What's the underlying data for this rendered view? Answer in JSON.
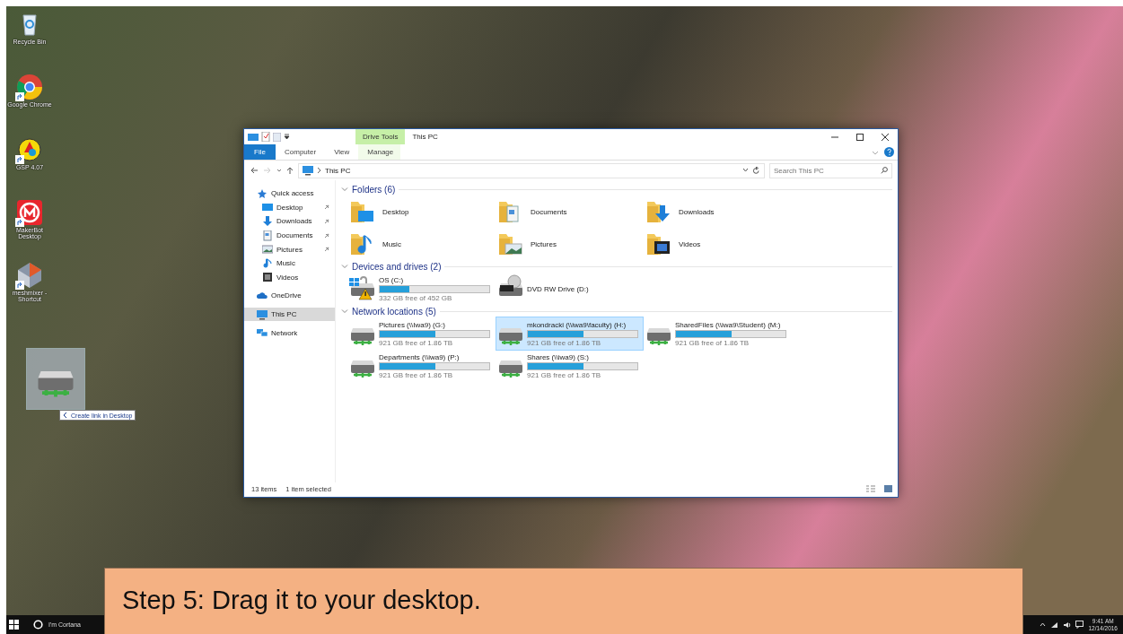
{
  "desktop": {
    "icons": [
      {
        "label": "Recycle Bin",
        "kind": "recycle",
        "shortcut": false
      },
      {
        "label": "Google Chrome",
        "kind": "chrome",
        "shortcut": true
      },
      {
        "label": "GSP 4.07",
        "kind": "gsp",
        "shortcut": true
      },
      {
        "label": "MakerBot Desktop",
        "kind": "makerbot",
        "shortcut": true
      },
      {
        "label": "meshmixer - Shortcut",
        "kind": "meshmixer",
        "shortcut": true
      }
    ],
    "drag_tooltip": "Create link in Desktop"
  },
  "window": {
    "context_tab": "Drive Tools",
    "title": "This PC",
    "ribbon_tabs": [
      {
        "label": "File",
        "kind": "file"
      },
      {
        "label": "Computer",
        "kind": "plain"
      },
      {
        "label": "View",
        "kind": "plain"
      },
      {
        "label": "Manage",
        "kind": "context"
      }
    ],
    "address": "This PC",
    "search": {
      "placeholder": "Search This PC"
    },
    "navigation": [
      {
        "label": "Quick access",
        "kind": "star",
        "selected": false,
        "children": [
          {
            "label": "Desktop",
            "kind": "desktop",
            "pinned": true,
            "selected": false
          },
          {
            "label": "Downloads",
            "kind": "downloads",
            "pinned": true,
            "selected": false
          },
          {
            "label": "Documents",
            "kind": "documents",
            "pinned": true,
            "selected": false
          },
          {
            "label": "Pictures",
            "kind": "pictures",
            "pinned": true,
            "selected": false
          },
          {
            "label": "Music",
            "kind": "music",
            "pinned": false,
            "selected": false
          },
          {
            "label": "Videos",
            "kind": "videos",
            "pinned": false,
            "selected": false
          }
        ]
      },
      {
        "label": "OneDrive",
        "kind": "cloud",
        "selected": false
      },
      {
        "label": "This PC",
        "kind": "pc",
        "selected": true
      },
      {
        "label": "Network",
        "kind": "network",
        "selected": false
      }
    ],
    "groups": [
      {
        "title": "Folders (6)",
        "kind": "folders",
        "expanded": true,
        "items": [
          {
            "label": "Desktop",
            "kind": "desktop",
            "selected": false
          },
          {
            "label": "Documents",
            "kind": "documents",
            "selected": false
          },
          {
            "label": "Downloads",
            "kind": "downloads",
            "selected": false
          },
          {
            "label": "Music",
            "kind": "music",
            "selected": false
          },
          {
            "label": "Pictures",
            "kind": "pictures",
            "selected": false
          },
          {
            "label": "Videos",
            "kind": "videos",
            "selected": false
          }
        ]
      },
      {
        "title": "Devices and drives (2)",
        "kind": "drives",
        "expanded": true,
        "items": [
          {
            "label": "OS (C:)",
            "kind": "system",
            "level": 0.27,
            "free": "332 GB free of 452 GB",
            "selected": false
          },
          {
            "label": "DVD RW Drive (D:)",
            "kind": "dvd",
            "selected": false
          }
        ]
      },
      {
        "title": "Network locations (5)",
        "kind": "drives",
        "expanded": true,
        "items": [
          {
            "label": "Pictures (\\\\Iwa9) (G:)",
            "kind": "network",
            "level": 0.51,
            "free": "921 GB free of 1.86 TB",
            "selected": false
          },
          {
            "label": "mkondracki (\\\\iwa9\\faculty) (H:)",
            "kind": "network",
            "level": 0.51,
            "free": "921 GB free of 1.86 TB",
            "selected": true
          },
          {
            "label": "SharedFiles (\\\\iwa9\\Student) (M:)",
            "kind": "network",
            "level": 0.51,
            "free": "921 GB free of 1.86 TB",
            "selected": false
          },
          {
            "label": "Departments (\\\\iwa9) (P:)",
            "kind": "network",
            "level": 0.51,
            "free": "921 GB free of 1.86 TB",
            "selected": false
          },
          {
            "label": "Shares (\\\\iwa9) (S:)",
            "kind": "network",
            "level": 0.51,
            "free": "921 GB free of 1.86 TB",
            "selected": false
          }
        ]
      }
    ],
    "status_bar": {
      "count": "13 items",
      "selection": "1 item selected"
    }
  },
  "caption": "Step 5: Drag it to your desktop.",
  "taskbar": {
    "search_placeholder": "I'm Cortana",
    "time": "9:41 AM",
    "date": "12/14/2016"
  }
}
